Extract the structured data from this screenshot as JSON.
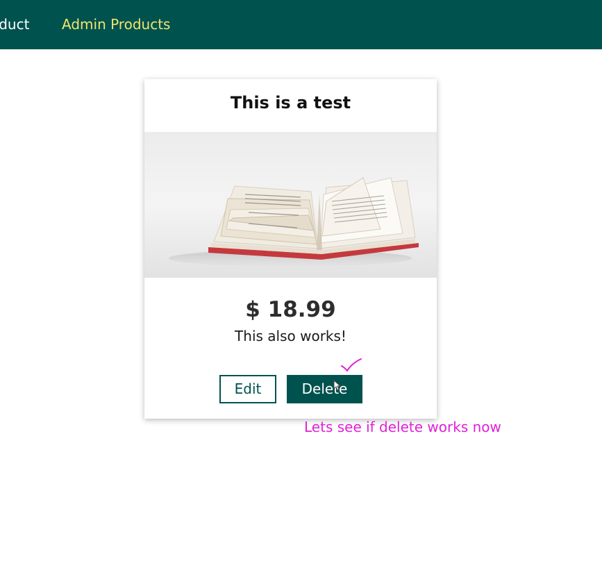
{
  "nav": {
    "partial_item": "oduct",
    "active_item": "Admin Products"
  },
  "product_card": {
    "title": "This is a test",
    "image_icon": "open-book-image",
    "price": "$ 18.99",
    "description": "This also works!",
    "edit_label": "Edit",
    "delete_label": "Delete"
  },
  "annotation": {
    "text": "Lets see if delete works now",
    "color": "#e020d8"
  },
  "colors": {
    "header_bg": "#00524f",
    "active_nav": "#f0e66a",
    "primary": "#00524f"
  }
}
